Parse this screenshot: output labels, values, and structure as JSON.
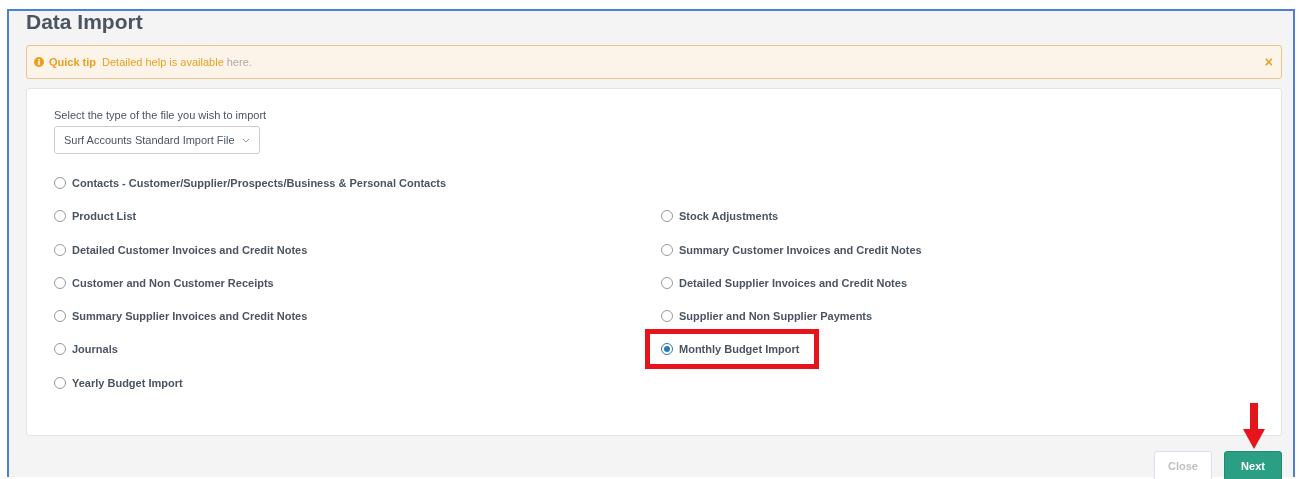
{
  "title": "Data Import",
  "tip": {
    "label": "Quick tip",
    "message": "Detailed help is available",
    "link": "here.",
    "close": "×"
  },
  "file_type": {
    "label": "Select the type of the file you wish to import",
    "value": "Surf Accounts Standard Import File"
  },
  "rows": [
    {
      "left": {
        "label": "Contacts - Customer/Supplier/Prospects/Business & Personal Contacts",
        "selected": false,
        "highlighted": false
      }
    },
    {
      "left": {
        "label": "Product List",
        "selected": false,
        "highlighted": false
      },
      "right": {
        "label": "Stock Adjustments",
        "selected": false,
        "highlighted": false
      }
    },
    {
      "left": {
        "label": "Detailed Customer Invoices and Credit Notes",
        "selected": false,
        "highlighted": false
      },
      "right": {
        "label": "Summary Customer Invoices and Credit Notes",
        "selected": false,
        "highlighted": false
      }
    },
    {
      "left": {
        "label": "Customer and Non Customer Receipts",
        "selected": false,
        "highlighted": false
      },
      "right": {
        "label": "Detailed Supplier Invoices and Credit Notes",
        "selected": false,
        "highlighted": false
      }
    },
    {
      "left": {
        "label": "Summary Supplier Invoices and Credit Notes",
        "selected": false,
        "highlighted": false
      },
      "right": {
        "label": "Supplier and Non Supplier Payments",
        "selected": false,
        "highlighted": false
      }
    },
    {
      "left": {
        "label": "Journals",
        "selected": false,
        "highlighted": false
      },
      "right": {
        "label": "Monthly Budget Import",
        "selected": true,
        "highlighted": true
      }
    },
    {
      "left": {
        "label": "Yearly Budget Import",
        "selected": false,
        "highlighted": false
      }
    }
  ],
  "buttons": [
    {
      "label": "Close",
      "kind": "secondary",
      "disabled": true,
      "arrow_marker": false
    },
    {
      "label": "Next",
      "kind": "primary",
      "disabled": false,
      "arrow_marker": true
    }
  ]
}
